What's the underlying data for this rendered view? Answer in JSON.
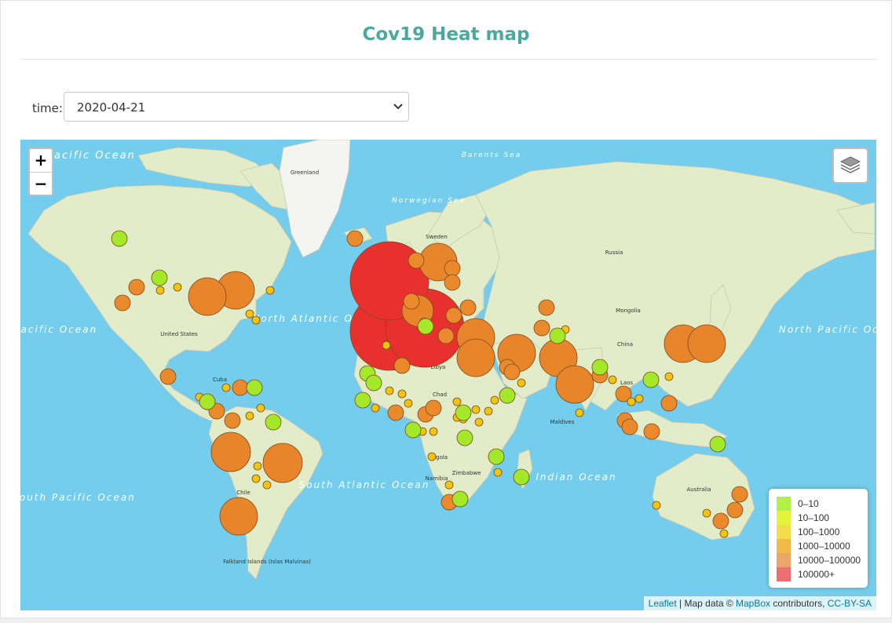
{
  "page": {
    "title": "Cov19 Heat map"
  },
  "controls": {
    "time_label": "time:",
    "time_value": "2020-04-21"
  },
  "map": {
    "zoom_in": "+",
    "zoom_out": "−",
    "layers_icon": "layers-icon",
    "colors": {
      "ocean": "#74cdec",
      "land": "#e3ecc9",
      "ice": "#f4f4f1"
    },
    "labels": {
      "north_pacific_w": "North Pacific Ocean",
      "north_pacific_e": "North Pacific Ocean",
      "north_atlantic": "North Atlantic Ocean",
      "south_atlantic": "South Atlantic Ocean",
      "south_pacific": "South Pacific Ocean",
      "indian": "Indian Ocean",
      "pacific_ocean": "Pacific Ocean",
      "greenland": "Greenland",
      "russia": "Russia",
      "united_states": "United States",
      "china": "China",
      "mongolia": "Mongolia",
      "australia": "Australia",
      "sweden": "Sweden",
      "barents_sea": "Barents Sea",
      "norwegian_sea": "Norwegian Sea",
      "chile": "Chile",
      "angola": "Angola",
      "namibia": "Namibia",
      "zimbabwe": "Zimbabwe",
      "chad": "Chad",
      "libya": "Libya",
      "laos": "Laos",
      "cuba": "Cuba",
      "maldives": "Maldives",
      "falkland": "Falkland Islands (Islas Malvinas)"
    }
  },
  "legend": {
    "items": [
      {
        "label": "0–10",
        "color": "#b2f048"
      },
      {
        "label": "10–100",
        "color": "#e4f43a"
      },
      {
        "label": "100–1000",
        "color": "#f4dc4a"
      },
      {
        "label": "1000–10000",
        "color": "#f2b84a"
      },
      {
        "label": "10000–100000",
        "color": "#eea56c"
      },
      {
        "label": "100000+",
        "color": "#ee6e74"
      }
    ]
  },
  "attribution": {
    "leaflet": "Leaflet",
    "text1": " | Map data © ",
    "mapbox": "MapBox",
    "text2": " contributors, ",
    "license": "CC-BY-SA"
  },
  "bubble_colors": {
    "c0_10": "#a3e829",
    "c100_1000": "#f1c40f",
    "c1000_10000": "#ea8a2c",
    "c10000_100000": "#e8842a",
    "c100000_plus": "#e8302e"
  }
}
